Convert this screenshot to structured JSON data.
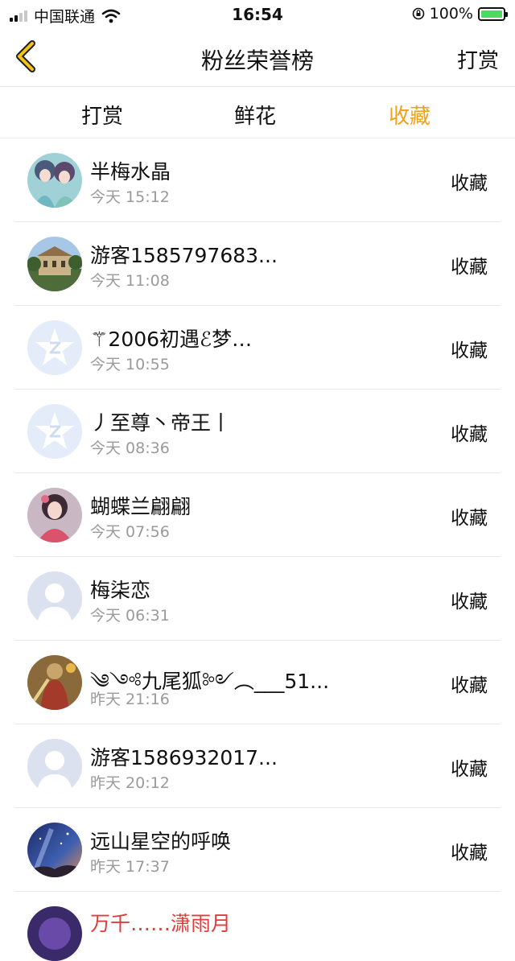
{
  "status_bar": {
    "carrier": "中国联通",
    "time": "16:54",
    "battery": "100%",
    "battery_level": 1.0
  },
  "navbar": {
    "title": "粉丝荣誉榜",
    "action": "打赏"
  },
  "tabs": [
    {
      "label": "打赏",
      "active": false
    },
    {
      "label": "鲜花",
      "active": false
    },
    {
      "label": "收藏",
      "active": true
    }
  ],
  "colors": {
    "accent": "#f3a01a",
    "back_icon": "#f2c318",
    "battery_fill": "#4cd964"
  },
  "items": [
    {
      "name": "半梅水晶",
      "time": "今天 15:12",
      "action": "收藏",
      "avatar": "anime-girls"
    },
    {
      "name": "游客1585797683...",
      "time": "今天 11:08",
      "action": "收藏",
      "avatar": "building-photo"
    },
    {
      "name": "⚚2006初遇ℰ梦…",
      "time": "今天 10:55",
      "action": "收藏",
      "avatar": "qq-star-default"
    },
    {
      "name": "丿至尊丶帝王丨",
      "time": "今天 08:36",
      "action": "收藏",
      "avatar": "qq-star-default"
    },
    {
      "name": "蝴蝶兰翩翩",
      "time": "今天 07:56",
      "action": "收藏",
      "avatar": "anime-woman"
    },
    {
      "name": "梅柒恋",
      "time": "今天 06:31",
      "action": "收藏",
      "avatar": "default-person"
    },
    {
      "name": "༄༺九尾狐༻︵___51...",
      "time": "昨天 21:16",
      "action": "收藏",
      "avatar": "warrior-art"
    },
    {
      "name": "游客1586932017...",
      "time": "昨天 20:12",
      "action": "收藏",
      "avatar": "default-person"
    },
    {
      "name": "远山星空的呼唤",
      "time": "昨天 17:37",
      "action": "收藏",
      "avatar": "starry-sky"
    }
  ],
  "partial_item": {
    "name": "万千……潇雨月",
    "avatar": "purple-art"
  }
}
